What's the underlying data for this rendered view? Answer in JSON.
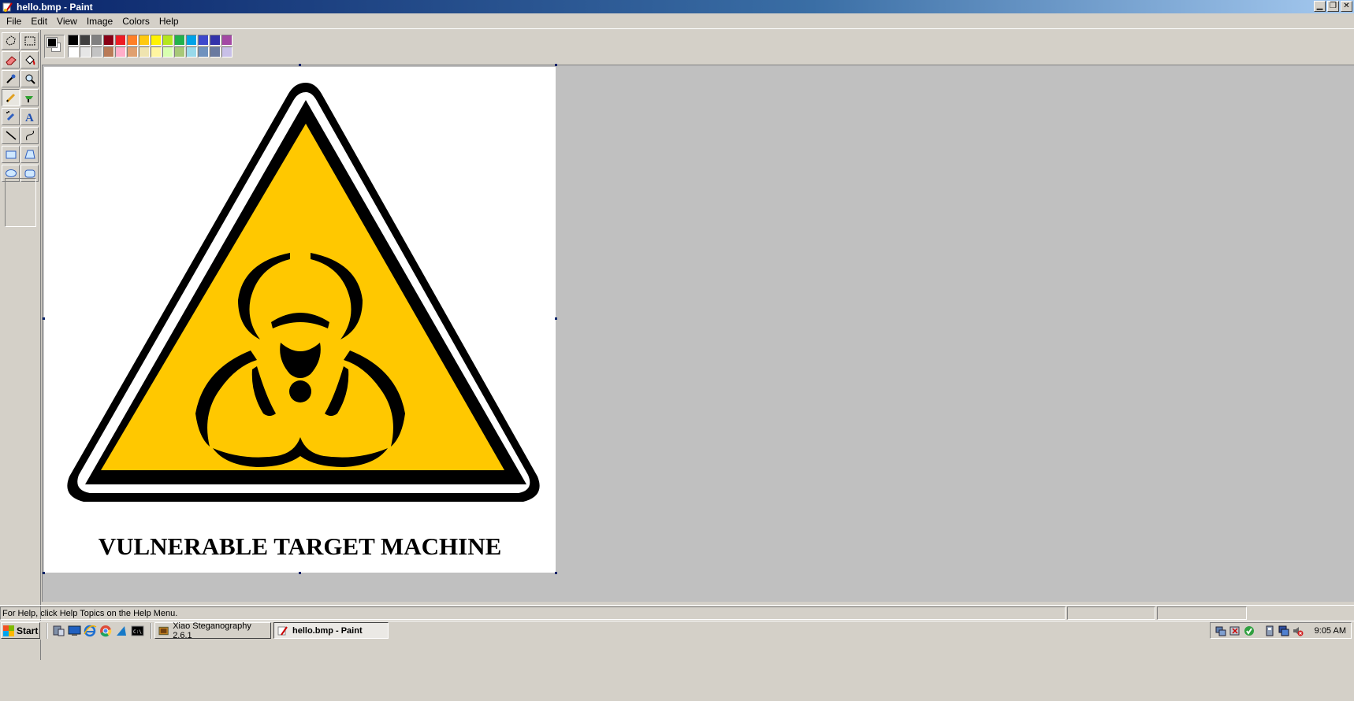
{
  "window": {
    "title": "hello.bmp - Paint"
  },
  "menu": [
    "File",
    "Edit",
    "View",
    "Image",
    "Colors",
    "Help"
  ],
  "palette": {
    "row1": [
      "#000000",
      "#404040",
      "#808080",
      "#880015",
      "#ed1c24",
      "#ff7f27",
      "#ffc90e",
      "#fff200",
      "#b5e61d",
      "#22b14c",
      "#00a2e8",
      "#3f48cc",
      "#3333aa",
      "#a349a4"
    ],
    "row2": [
      "#ffffff",
      "#e6e6e6",
      "#c3c3c3",
      "#b97a57",
      "#ffaec9",
      "#e0a070",
      "#efe4b0",
      "#fff5a0",
      "#d8ffb0",
      "#a8c878",
      "#99d9ea",
      "#7092be",
      "#6a7aa0",
      "#c8bfe7"
    ],
    "foreground": "#000000",
    "background": "#ffffff"
  },
  "canvas": {
    "sign_fill": "#ffc800",
    "caption": "VULNERABLE TARGET MACHINE"
  },
  "status": {
    "help_text": "For Help, click Help Topics on the Help Menu."
  },
  "taskbar": {
    "start_label": "Start",
    "tasks": [
      "Xiao Steganography 2.6.1",
      "hello.bmp - Paint"
    ],
    "clock": "9:05 AM"
  }
}
